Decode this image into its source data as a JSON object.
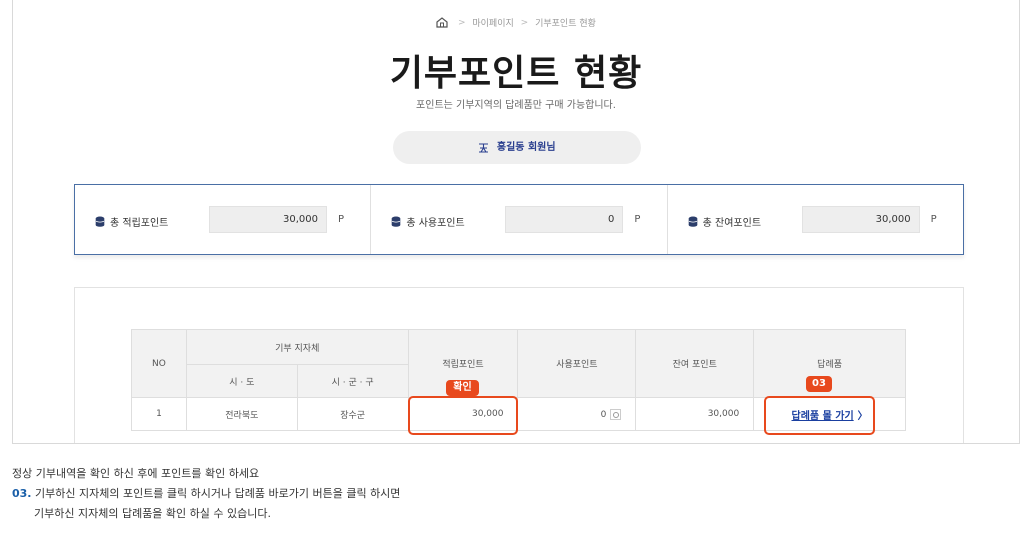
{
  "breadcrumb": {
    "item1": "마이페이지",
    "item2": "기부포인트 현황",
    "home_icon": "home-icon"
  },
  "page_title": "기부포인트 현황",
  "subtitle": "포인트는 기부지역의 답례품만 구매 가능합니다.",
  "user": {
    "name_label": "홍길동 회원님",
    "icon": "user-icon"
  },
  "summary": [
    {
      "label": "총 적립포인트",
      "value": "30,000",
      "unit": "P",
      "icon": "database-icon"
    },
    {
      "label": "총 사용포인트",
      "value": "0",
      "unit": "P",
      "icon": "database-icon"
    },
    {
      "label": "총 잔여포인트",
      "value": "30,000",
      "unit": "P",
      "icon": "database-icon"
    }
  ],
  "table": {
    "headers": {
      "no": "NO",
      "region_group": "기부 지자체",
      "province": "시 · 도",
      "city": "시 · 군 · 구",
      "earned": "적립포인트",
      "used": "사용포인트",
      "remaining": "잔여 포인트",
      "gift": "답례품"
    },
    "rows": [
      {
        "no": "1",
        "province": "전라북도",
        "city": "장수군",
        "earned": "30,000",
        "used": "0",
        "remaining": "30,000",
        "gift_link": "답례품 몰 가기",
        "gift_chevron": "〉"
      }
    ]
  },
  "callouts": {
    "confirm_tag": "확인",
    "step_tag": "03",
    "accent_color": "#e8491d"
  },
  "instructions": {
    "line1": "정상 기부내역을 확인 하신 후에 포인트를 확인 하세요",
    "step_number": "03.",
    "line2": " 기부하신 지자체의 포인트를 클릭 하시거나 답례품 바로가기 버튼을 클릭 하시면",
    "line3": "기부하신 지자체의 답례품을 확인 하실 수 있습니다."
  }
}
